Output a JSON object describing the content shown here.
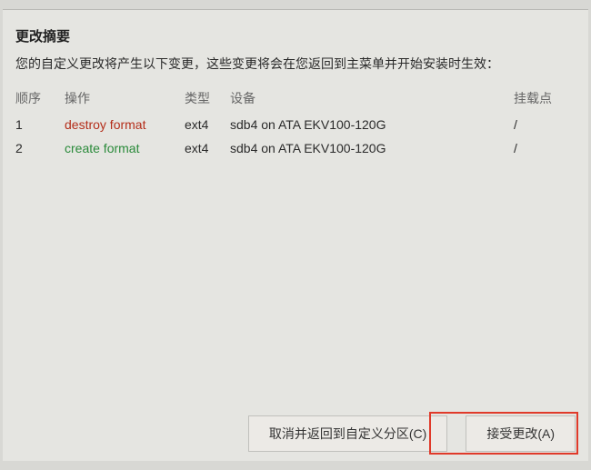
{
  "dialog": {
    "title": "更改摘要",
    "description": "您的自定义更改将产生以下变更，这些变更将会在您返回到主菜单并开始安装时生效：",
    "columns": {
      "seq": "顺序",
      "op": "操作",
      "type": "类型",
      "device": "设备",
      "mount": "挂载点"
    },
    "rows": [
      {
        "seq": "1",
        "op": "destroy format",
        "op_kind": "destroy",
        "type": "ext4",
        "device": "sdb4 on ATA EKV100-120G",
        "mount": "/"
      },
      {
        "seq": "2",
        "op": "create format",
        "op_kind": "create",
        "type": "ext4",
        "device": "sdb4 on ATA EKV100-120G",
        "mount": "/"
      }
    ],
    "buttons": {
      "cancel": "取消并返回到自定义分区(C)",
      "accept": "接受更改(A)"
    }
  }
}
